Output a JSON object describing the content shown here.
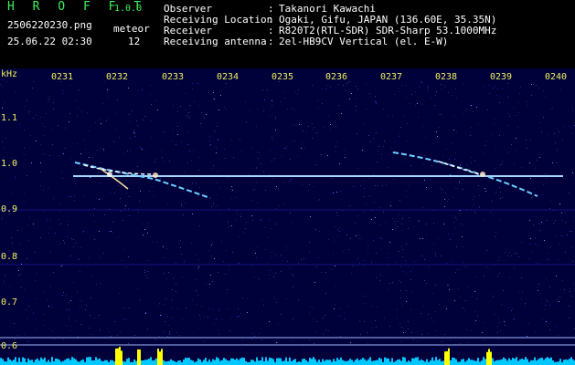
{
  "header": {
    "app_title": "H R O F F T",
    "app_version": "1.0.0",
    "file_name": "2506220230.png",
    "meteor_label": "meteor",
    "datetime": "25.06.22 02:30",
    "meteor_count": "12"
  },
  "info": [
    {
      "label": "Observer",
      "value": "Takanori Kawachi"
    },
    {
      "label": "Receiving Location",
      "value": "Ogaki, Gifu, JAPAN (136.60E, 35.35N)"
    },
    {
      "label": "Receiver",
      "value": "R820T2(RTL-SDR) SDR-Sharp 53.1000MHz"
    },
    {
      "label": "Receiving antenna",
      "value": "2el-HB9CV Vertical (el. E-W)"
    }
  ],
  "spectrogram": {
    "y_unit": "kHz",
    "y_ticks": [
      "1.1",
      "1.0",
      "0.9",
      "0.8",
      "0.7",
      "0.6"
    ],
    "x_ticks": [
      "0231",
      "0232",
      "0233",
      "0234",
      "0235",
      "0236",
      "0237",
      "0238",
      "0239",
      "0240"
    ],
    "colors": {
      "background": "#00003a",
      "carrier": "#8fd0ff",
      "echo": "#ffffff",
      "level_fill": "#00c8ff",
      "peak": "#ffff00",
      "tick_label": "#f0f060"
    }
  }
}
